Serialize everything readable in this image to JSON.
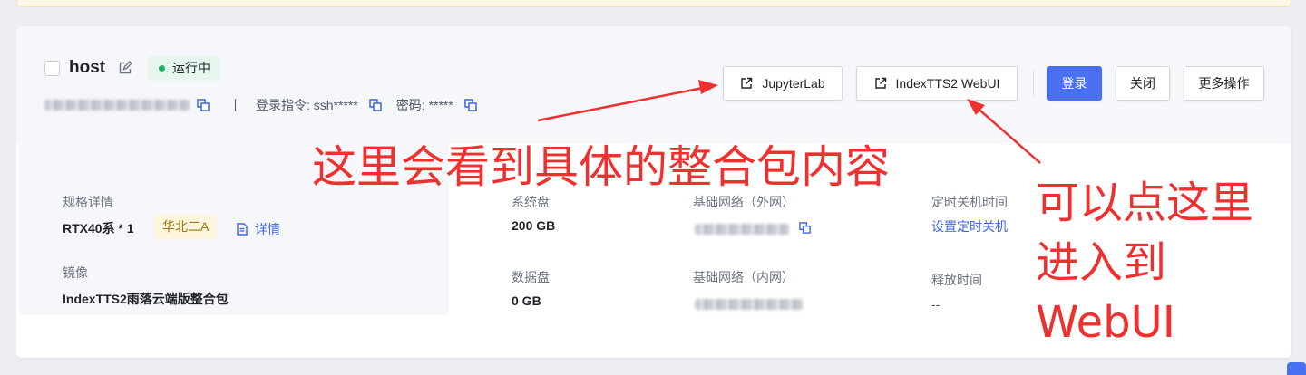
{
  "instance": {
    "name": "host",
    "status": "运行中",
    "status_color": "#19b45d",
    "id_label": "ID:",
    "id_value": "ubuntu-1jdi332xxxg",
    "login_cmd": "登录指令: ssh*****",
    "password": "密码: *****"
  },
  "actions": {
    "jupyter": "JupyterLab",
    "webui": "IndexTTS2 WebUI",
    "login": "登录",
    "close": "关闭",
    "more": "更多操作",
    "primary_color": "#4a70f2"
  },
  "spec": {
    "spec_label": "规格详情",
    "spec_value": "RTX40系 * 1",
    "region": "华北二A",
    "detail": "详情",
    "image_label": "镜像",
    "image_value": "IndexTTS2雨落云端版整合包"
  },
  "disks": {
    "system_label": "系统盘",
    "system_value": "200 GB",
    "data_label": "数据盘",
    "data_value": "0 GB"
  },
  "network": {
    "external_label": "基础网络（外网）",
    "internal_label": "基础网络（内网）"
  },
  "schedule": {
    "shutdown_label": "定时关机时间",
    "shutdown_link": "设置定时关机",
    "release_label": "释放时间",
    "release_value": "--"
  },
  "annotations": {
    "middle": "这里会看到具体的整合包内容",
    "right_line1": "可以点这里",
    "right_line2": "进入到",
    "right_line3": "WebUI",
    "color": "#f0302f"
  },
  "icons": [
    "external-link-icon",
    "edit-icon",
    "copy-icon",
    "document-icon"
  ]
}
